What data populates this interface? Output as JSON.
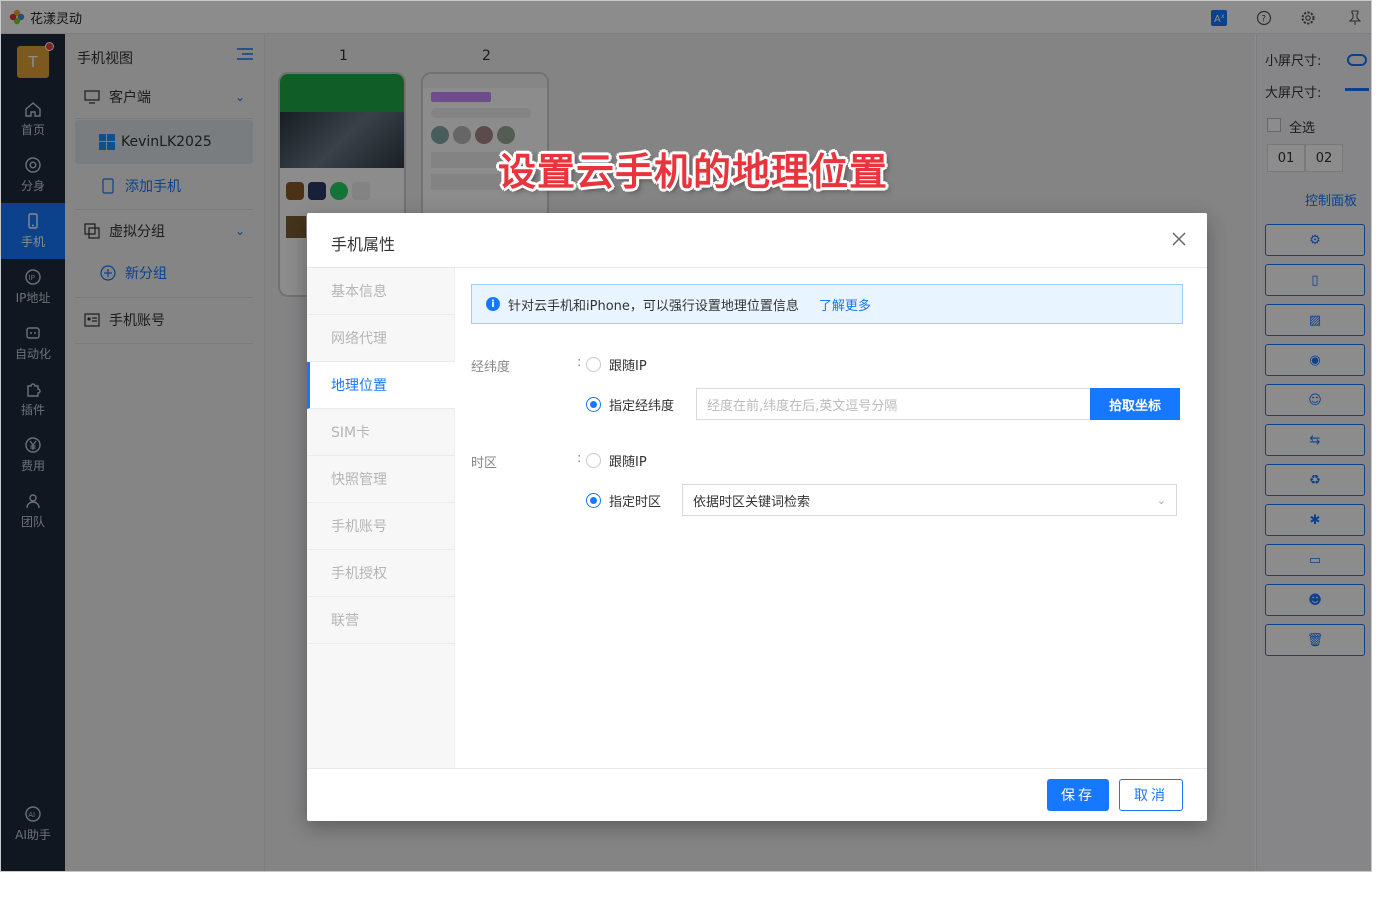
{
  "window": {
    "title": "花漾灵动"
  },
  "titlebar": {
    "icons": [
      "translate-icon",
      "help-icon",
      "settings-icon",
      "pin-icon"
    ]
  },
  "rail": {
    "avatar_initial": "T",
    "items": [
      {
        "label": "首页",
        "icon": "home-icon"
      },
      {
        "label": "分身",
        "icon": "browser-icon"
      },
      {
        "label": "手机",
        "icon": "phone-icon",
        "active": true
      },
      {
        "label": "IP地址",
        "icon": "ip-icon"
      },
      {
        "label": "自动化",
        "icon": "robot-icon"
      },
      {
        "label": "插件",
        "icon": "puzzle-icon"
      },
      {
        "label": "费用",
        "icon": "yen-icon"
      },
      {
        "label": "团队",
        "icon": "team-icon"
      },
      {
        "label": "AI助手",
        "icon": "ai-icon"
      }
    ]
  },
  "panel2": {
    "title": "手机视图",
    "client_label": "客户端",
    "device_name": "KevinLK2025",
    "add_phone": "添加手机",
    "virtual_group": "虚拟分组",
    "new_group": "新分组",
    "phone_account": "手机账号"
  },
  "center": {
    "phones": [
      {
        "num": "1"
      },
      {
        "num": "2"
      }
    ]
  },
  "banner": {
    "text": "设置云手机的地理位置"
  },
  "rpanel": {
    "small_size": "小屏尺寸:",
    "large_size": "大屏尺寸:",
    "select_all": "全选",
    "chips": [
      "01",
      "02"
    ],
    "control_panel": "控制面板"
  },
  "modal": {
    "title": "手机属性",
    "tabs": [
      "基本信息",
      "网络代理",
      "地理位置",
      "SIM卡",
      "快照管理",
      "手机账号",
      "手机授权",
      "联营"
    ],
    "active_tab": 2,
    "info_text": "针对云手机和iPhone，可以强行设置地理位置信息",
    "info_link": "了解更多",
    "latlng": {
      "label": "经纬度",
      "colon": ":",
      "option_follow": "跟随IP",
      "option_specify": "指定经纬度",
      "placeholder": "经度在前,纬度在后,英文逗号分隔",
      "pick_button": "拾取坐标"
    },
    "timezone": {
      "label": "时区",
      "colon": ":",
      "option_follow": "跟随IP",
      "option_specify": "指定时区",
      "select_value": "依据时区关键词检索"
    },
    "save": "保存",
    "cancel": "取消"
  },
  "colors": {
    "primary": "#1677ff",
    "rail_bg": "#1f2b3d",
    "banner": "#e8343c"
  }
}
